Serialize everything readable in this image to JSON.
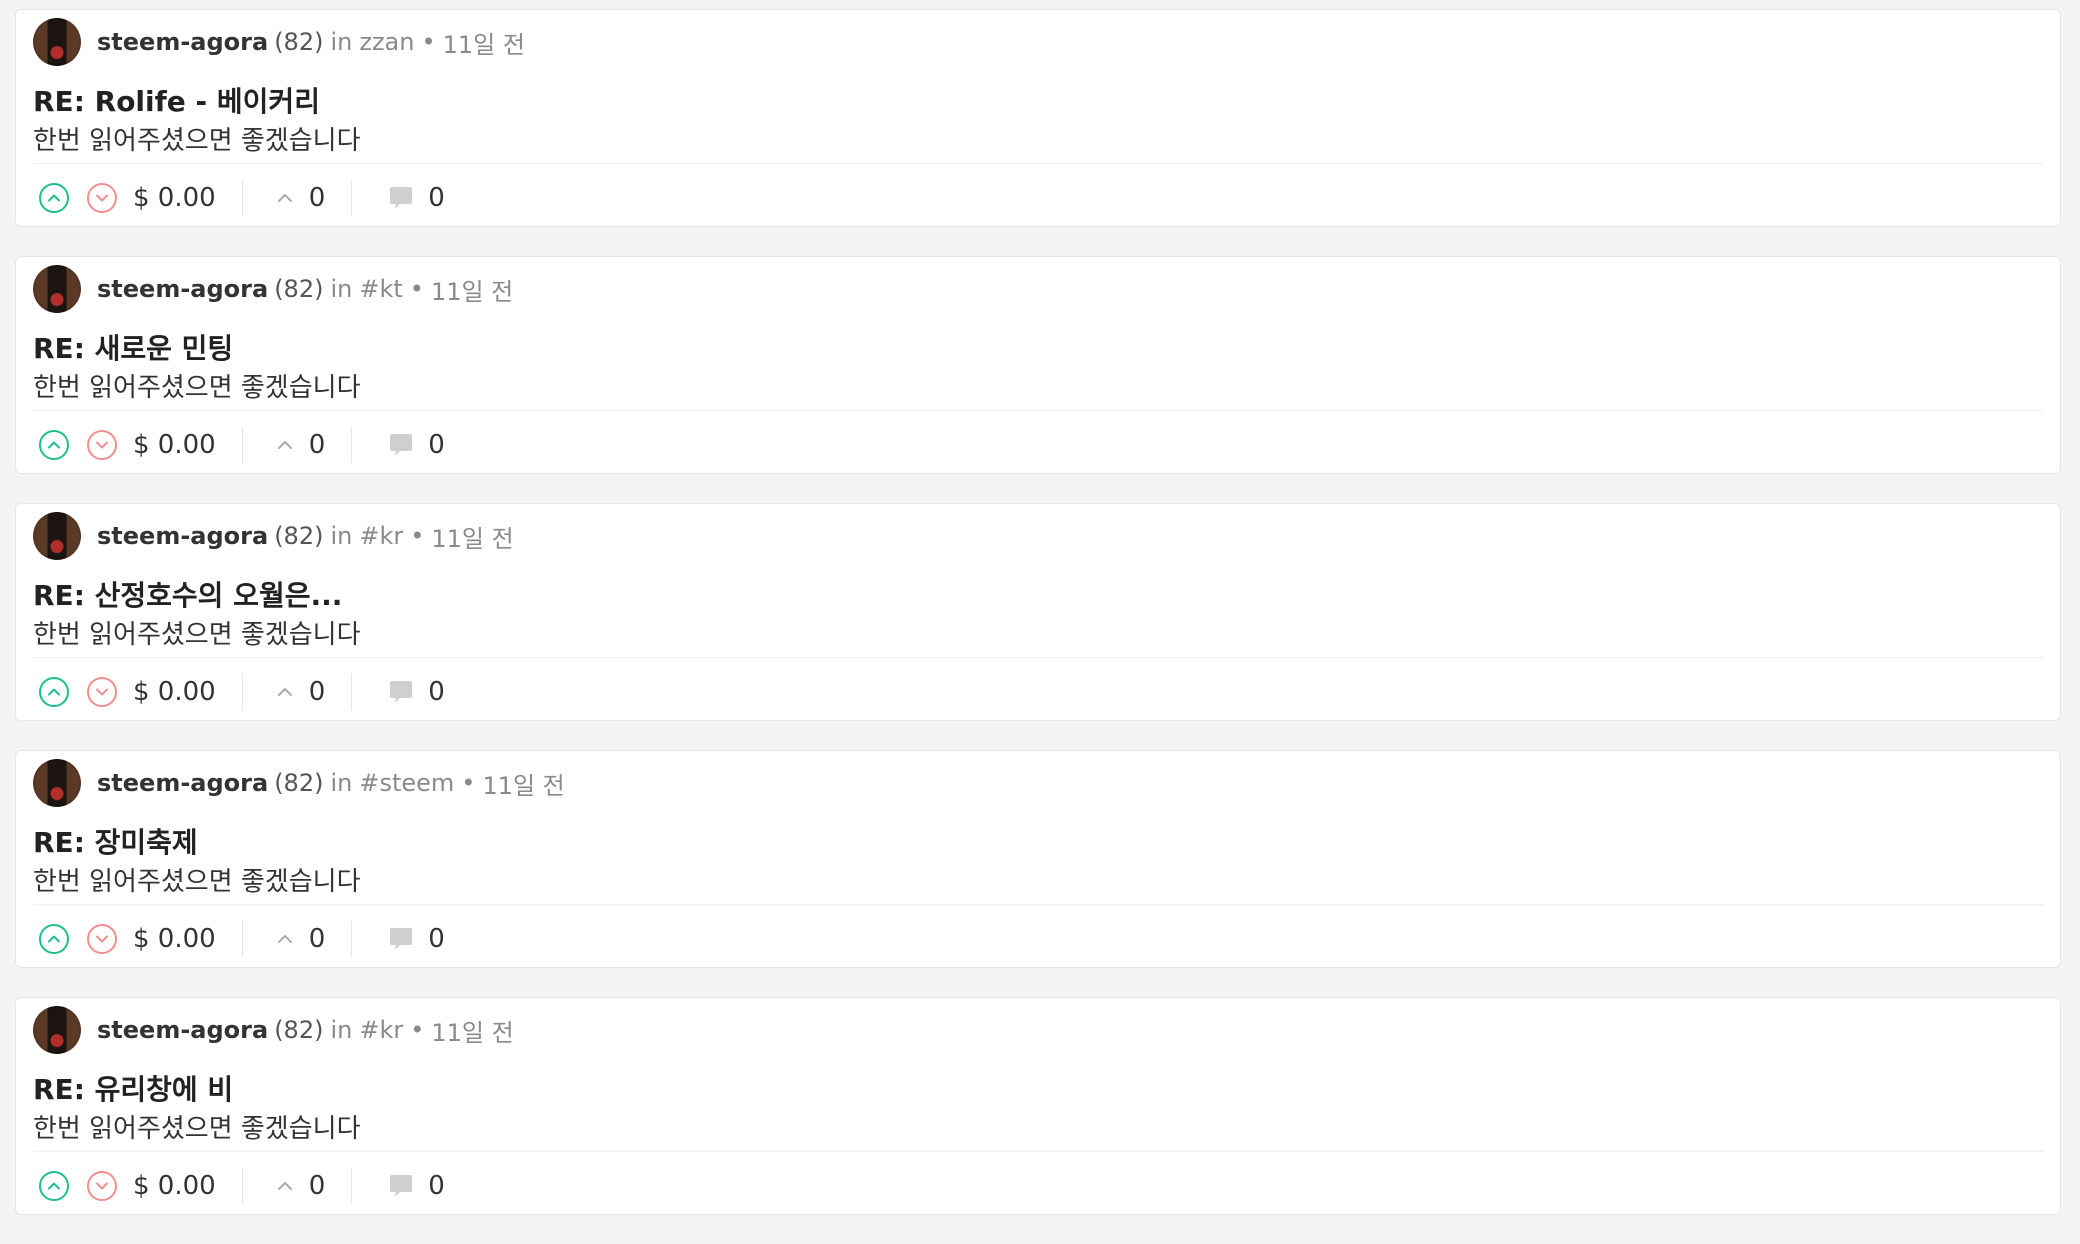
{
  "posts": [
    {
      "author": "steem-agora",
      "reputation": "(82)",
      "community_prefix": "in",
      "community": "zzan",
      "separator": "•",
      "time": "11일 전",
      "title": "RE: Rolife - 베이커리",
      "body": "한번 읽어주셨으면 좋겠습니다",
      "payout": "$ 0.00",
      "votes": "0",
      "comments": "0"
    },
    {
      "author": "steem-agora",
      "reputation": "(82)",
      "community_prefix": "in",
      "community": "#kt",
      "separator": "•",
      "time": "11일 전",
      "title": "RE: 새로운 민팅",
      "body": "한번 읽어주셨으면 좋겠습니다",
      "payout": "$ 0.00",
      "votes": "0",
      "comments": "0"
    },
    {
      "author": "steem-agora",
      "reputation": "(82)",
      "community_prefix": "in",
      "community": "#kr",
      "separator": "•",
      "time": "11일 전",
      "title": "RE: 산정호수의 오월은...",
      "body": "한번 읽어주셨으면 좋겠습니다",
      "payout": "$ 0.00",
      "votes": "0",
      "comments": "0"
    },
    {
      "author": "steem-agora",
      "reputation": "(82)",
      "community_prefix": "in",
      "community": "#steem",
      "separator": "•",
      "time": "11일 전",
      "title": "RE: 장미축제",
      "body": "한번 읽어주셨으면 좋겠습니다",
      "payout": "$ 0.00",
      "votes": "0",
      "comments": "0"
    },
    {
      "author": "steem-agora",
      "reputation": "(82)",
      "community_prefix": "in",
      "community": "#kr",
      "separator": "•",
      "time": "11일 전",
      "title": "RE: 유리창에 비",
      "body": "한번 읽어주셨으면 좋겠습니다",
      "payout": "$ 0.00",
      "votes": "0",
      "comments": "0"
    }
  ],
  "icons": {
    "upvote": "upvote-icon",
    "downvote": "downvote-icon",
    "vote_count": "chevron-up-icon",
    "comments": "comment-bubble-icon"
  },
  "colors": {
    "upvote": "#1fbf8f",
    "downvote": "#f08f8f",
    "muted": "#8a8a8a"
  }
}
